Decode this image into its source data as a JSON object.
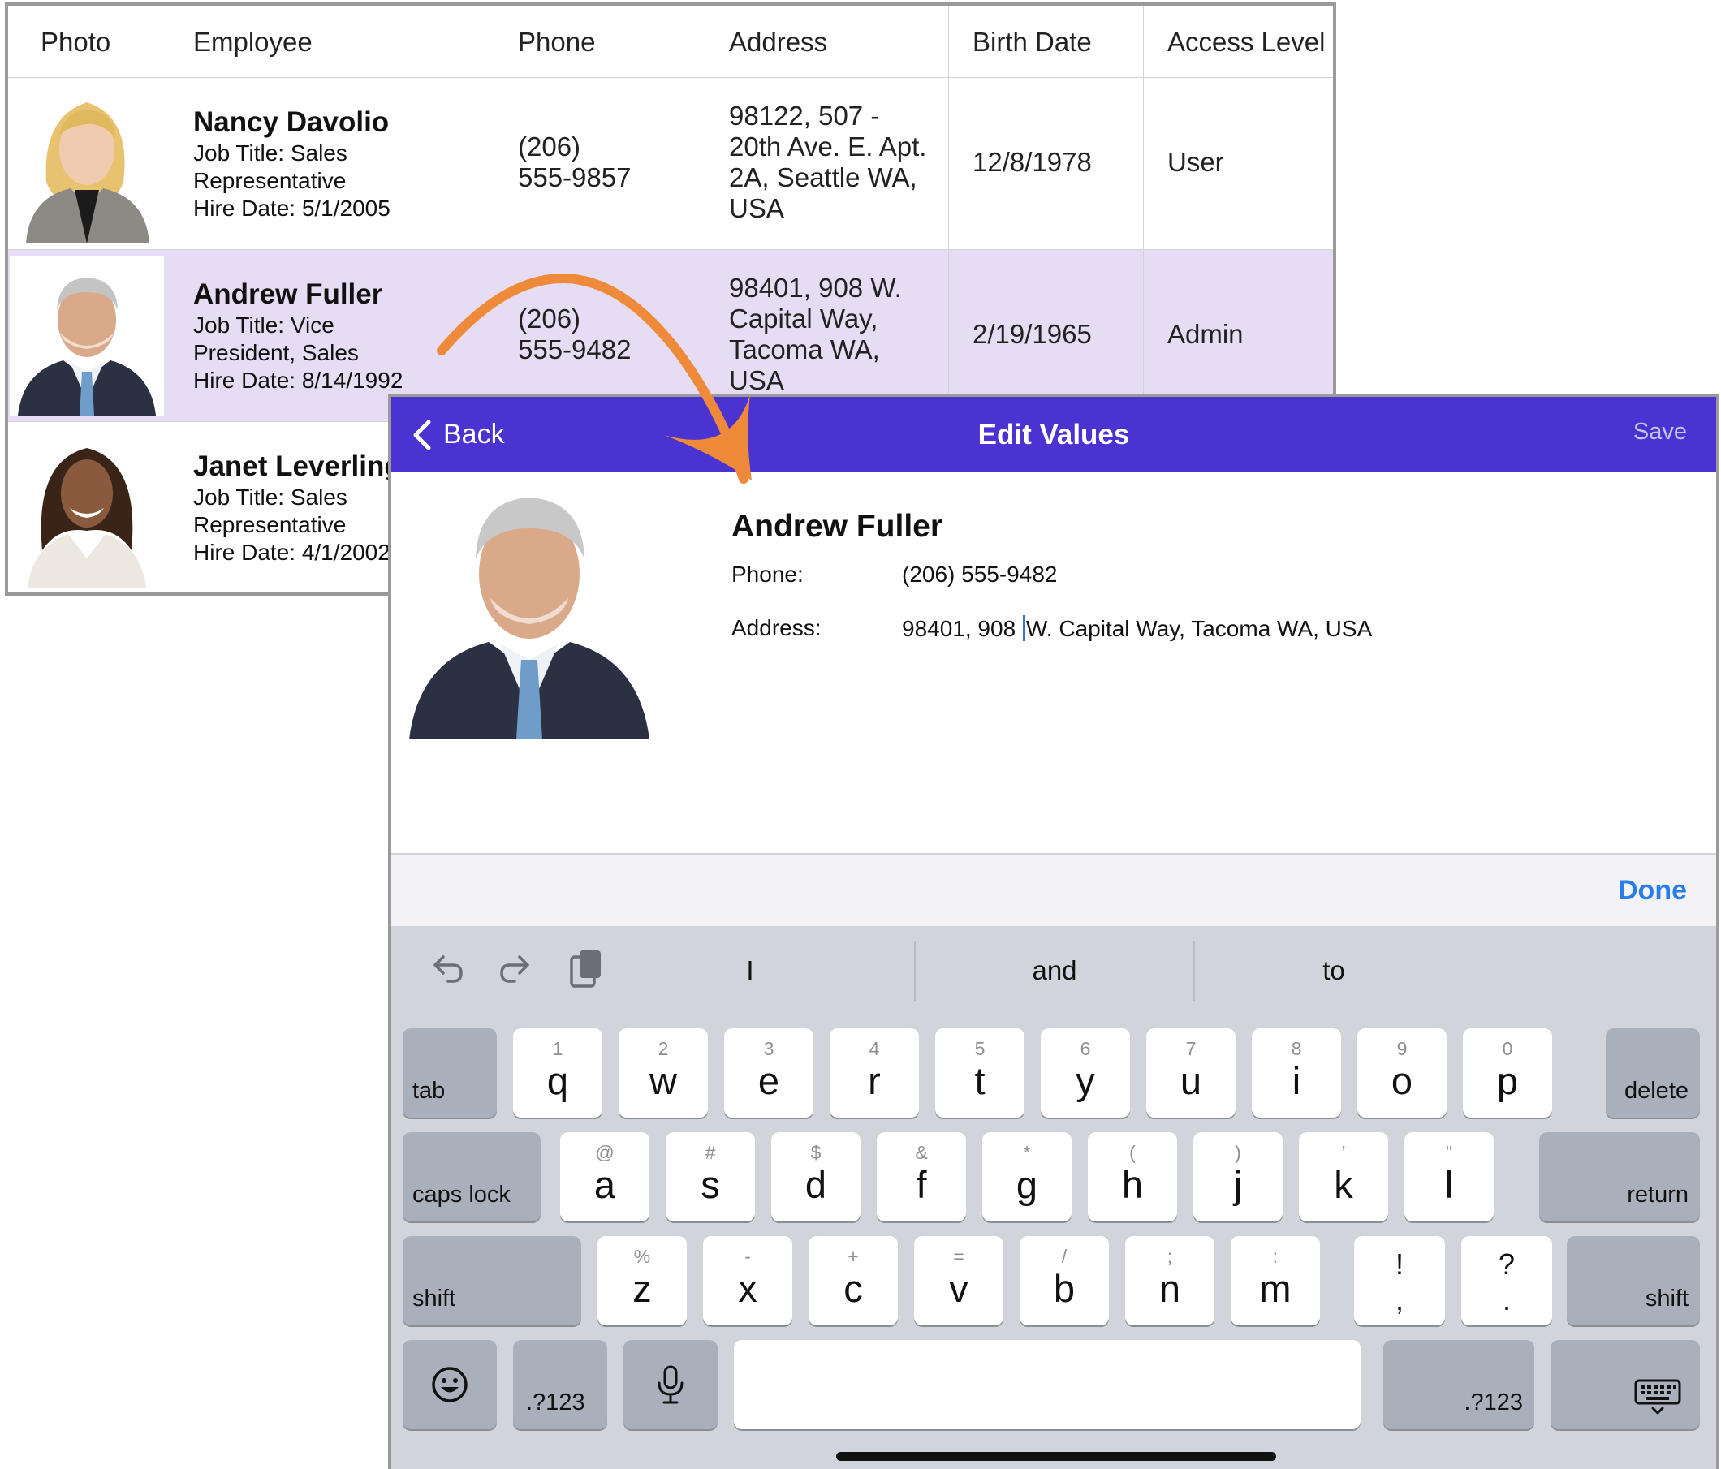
{
  "grid": {
    "columns": [
      "Photo",
      "Employee",
      "Phone",
      "Address",
      "Birth Date",
      "Access Level"
    ],
    "rows": [
      {
        "name": "Nancy Davolio",
        "job_lines": [
          "Job Title: Sales",
          "Representative"
        ],
        "hire": "Hire Date: 5/1/2005",
        "phone_lines": [
          "(206)",
          "555-9857"
        ],
        "address_lines": [
          "98122, 507 -",
          "20th Ave. E. Apt.",
          "2A, Seattle WA,",
          "USA"
        ],
        "birth": "12/8/1978",
        "access": "User",
        "selected": false
      },
      {
        "name": "Andrew Fuller",
        "job_lines": [
          "Job Title: Vice",
          "President, Sales"
        ],
        "hire": "Hire Date: 8/14/1992",
        "phone_lines": [
          "(206)",
          "555-9482"
        ],
        "address_lines": [
          "98401, 908 W.",
          "Capital Way,",
          "Tacoma WA,",
          "USA"
        ],
        "birth": "2/19/1965",
        "access": "Admin",
        "selected": true
      },
      {
        "name": "Janet Leverling",
        "job_lines": [
          "Job Title: Sales",
          "Representative"
        ],
        "hire": "Hire Date: 4/1/2002",
        "selected": false
      }
    ]
  },
  "editor": {
    "back_label": "Back",
    "title": "Edit Values",
    "save_label": "Save",
    "name": "Andrew Fuller",
    "phone_label": "Phone:",
    "phone_value": "(206) 555-9482",
    "address_label": "Address:",
    "address_before_caret": "98401, 908 ",
    "address_after_caret": "W. Capital Way, Tacoma WA, USA"
  },
  "accessory": {
    "done_label": "Done"
  },
  "keyboard": {
    "suggestions": [
      "I",
      "and",
      "to"
    ],
    "row1": [
      {
        "sub": "1",
        "main": "q"
      },
      {
        "sub": "2",
        "main": "w"
      },
      {
        "sub": "3",
        "main": "e"
      },
      {
        "sub": "4",
        "main": "r"
      },
      {
        "sub": "5",
        "main": "t"
      },
      {
        "sub": "6",
        "main": "y"
      },
      {
        "sub": "7",
        "main": "u"
      },
      {
        "sub": "8",
        "main": "i"
      },
      {
        "sub": "9",
        "main": "o"
      },
      {
        "sub": "0",
        "main": "p"
      }
    ],
    "row2": [
      {
        "sub": "@",
        "main": "a"
      },
      {
        "sub": "#",
        "main": "s"
      },
      {
        "sub": "$",
        "main": "d"
      },
      {
        "sub": "&",
        "main": "f"
      },
      {
        "sub": "*",
        "main": "g"
      },
      {
        "sub": "(",
        "main": "h"
      },
      {
        "sub": ")",
        "main": "j"
      },
      {
        "sub": "’",
        "main": "k"
      },
      {
        "sub": "\"",
        "main": "l"
      }
    ],
    "row3": [
      {
        "sub": "%",
        "main": "z"
      },
      {
        "sub": "-",
        "main": "x"
      },
      {
        "sub": "+",
        "main": "c"
      },
      {
        "sub": "=",
        "main": "v"
      },
      {
        "sub": "/",
        "main": "b"
      },
      {
        "sub": ";",
        "main": "n"
      },
      {
        "sub": ":",
        "main": "m"
      }
    ],
    "punct1": {
      "top": "!",
      "bottom": ","
    },
    "punct2": {
      "top": "?",
      "bottom": "."
    },
    "tab_label": "tab",
    "delete_label": "delete",
    "caps_label": "caps lock",
    "return_label": "return",
    "shift_label": "shift",
    "numbers_label": ".?123"
  },
  "colors": {
    "nav_bar": "#4a33d0",
    "selected_row": "#e6ddf5",
    "arrow": "#ef8a3a",
    "done": "#2a7ce8"
  },
  "icons": [
    "chevron-left-icon",
    "undo-icon",
    "redo-icon",
    "clipboard-icon",
    "emoji-icon",
    "microphone-icon",
    "keyboard-dismiss-icon"
  ]
}
